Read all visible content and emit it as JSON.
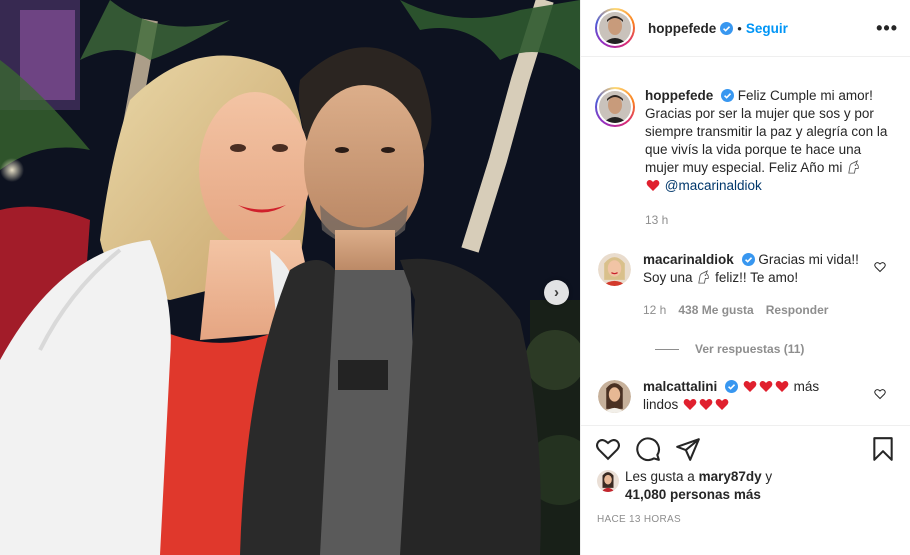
{
  "post": {
    "username": "hoppefede",
    "follow_label": "Seguir",
    "dot": "•",
    "more_icon": "more-horizontal-icon"
  },
  "caption": {
    "username": "hoppefede",
    "text": "Feliz Cumple mi amor! Gracias por ser la mujer que sos y por siempre transmitir la paz y alegría con la que vivís la vida porque te hace una mujer muy especial. Feliz Año mi",
    "mention": "@macarinaldiok",
    "age": "13 h"
  },
  "comments": [
    {
      "username": "macarinaldiok",
      "text_a": "Gracias mi vida!! Soy una",
      "text_b": "feliz!! Te amo!",
      "age": "12 h",
      "likes": "438 Me gusta",
      "reply_label": "Responder",
      "view_replies": "Ver respuestas (11)"
    },
    {
      "username": "malcattalini",
      "text_a": "más",
      "text_b": "lindos"
    }
  ],
  "likes": {
    "prefix": "Les gusta a",
    "user": "mary87dy",
    "joiner": "y",
    "count": "41,080 personas más"
  },
  "timestamp": "HACE 13 HORAS",
  "colors": {
    "accent_blue": "#0095f6",
    "mention_blue": "#00376b",
    "muted_gray": "#8e8e8e",
    "heart_red": "#ed4956",
    "text": "#262626"
  }
}
